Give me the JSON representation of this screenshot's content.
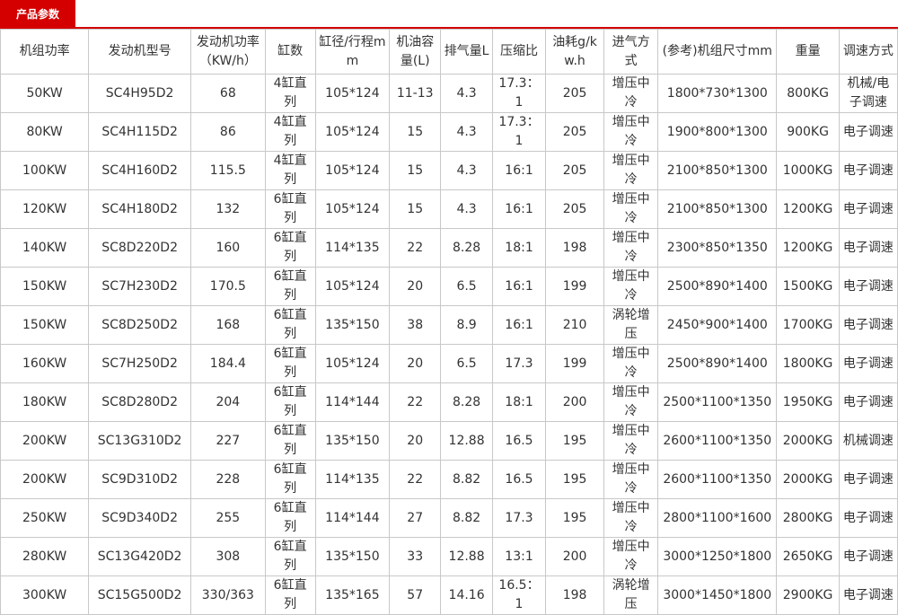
{
  "tab": {
    "label": "产品参数"
  },
  "table": {
    "headers": [
      "机组功率",
      "发动机型号",
      "发动机功率（KW/h）",
      "缸数",
      "缸径/行程mm",
      "机油容量(L)",
      "排气量L",
      "压缩比",
      "油耗g/kw.h",
      "进气方式",
      "(参考)机组尺寸mm",
      "重量",
      "调速方式"
    ],
    "rows": [
      [
        "50KW",
        "SC4H95D2",
        "68",
        "4缸直列",
        "105*124",
        "11-13",
        "4.3",
        "17.3：1",
        "205",
        "增压中冷",
        "1800*730*1300",
        "800KG",
        "机械/电子调速"
      ],
      [
        "80KW",
        "SC4H115D2",
        "86",
        "4缸直列",
        "105*124",
        "15",
        "4.3",
        "17.3：1",
        "205",
        "增压中冷",
        "1900*800*1300",
        "900KG",
        "电子调速"
      ],
      [
        "100KW",
        "SC4H160D2",
        "115.5",
        "4缸直列",
        "105*124",
        "15",
        "4.3",
        "16:1",
        "205",
        "增压中冷",
        "2100*850*1300",
        "1000KG",
        "电子调速"
      ],
      [
        "120KW",
        "SC4H180D2",
        "132",
        "6缸直列",
        "105*124",
        "15",
        "4.3",
        "16:1",
        "205",
        "增压中冷",
        "2100*850*1300",
        "1200KG",
        "电子调速"
      ],
      [
        "140KW",
        "SC8D220D2",
        "160",
        "6缸直列",
        "114*135",
        "22",
        "8.28",
        "18:1",
        "198",
        "增压中冷",
        "2300*850*1350",
        "1200KG",
        "电子调速"
      ],
      [
        "150KW",
        "SC7H230D2",
        "170.5",
        "6缸直列",
        "105*124",
        "20",
        "6.5",
        "16:1",
        "199",
        "增压中冷",
        "2500*890*1400",
        "1500KG",
        "电子调速"
      ],
      [
        "150KW",
        "SC8D250D2",
        "168",
        "6缸直列",
        "135*150",
        "38",
        "8.9",
        "16:1",
        "210",
        "涡轮增压",
        "2450*900*1400",
        "1700KG",
        "电子调速"
      ],
      [
        "160KW",
        "SC7H250D2",
        "184.4",
        "6缸直列",
        "105*124",
        "20",
        "6.5",
        "17.3",
        "199",
        "增压中冷",
        "2500*890*1400",
        "1800KG",
        "电子调速"
      ],
      [
        "180KW",
        "SC8D280D2",
        "204",
        "6缸直列",
        "114*144",
        "22",
        "8.28",
        "18:1",
        "200",
        "增压中冷",
        "2500*1100*1350",
        "1950KG",
        "电子调速"
      ],
      [
        "200KW",
        "SC13G310D2",
        "227",
        "6缸直列",
        "135*150",
        "20",
        "12.88",
        "16.5",
        "195",
        "增压中冷",
        "2600*1100*1350",
        "2000KG",
        "机械调速"
      ],
      [
        "200KW",
        "SC9D310D2",
        "228",
        "6缸直列",
        "114*135",
        "22",
        "8.82",
        "16.5",
        "195",
        "增压中冷",
        "2600*1100*1350",
        "2000KG",
        "电子调速"
      ],
      [
        "250KW",
        "SC9D340D2",
        "255",
        "6缸直列",
        "114*144",
        "27",
        "8.82",
        "17.3",
        "195",
        "增压中冷",
        "2800*1100*1600",
        "2800KG",
        "电子调速"
      ],
      [
        "280KW",
        "SC13G420D2",
        "308",
        "6缸直列",
        "135*150",
        "33",
        "12.88",
        "13:1",
        "200",
        "增压中冷",
        "3000*1250*1800",
        "2650KG",
        "电子调速"
      ],
      [
        "300KW",
        "SC15G500D2",
        "330/363",
        "6缸直列",
        "135*165",
        "57",
        "14.16",
        "16.5：1",
        "198",
        "涡轮增压",
        "3000*1450*1800",
        "2900KG",
        "电子调速"
      ]
    ]
  }
}
